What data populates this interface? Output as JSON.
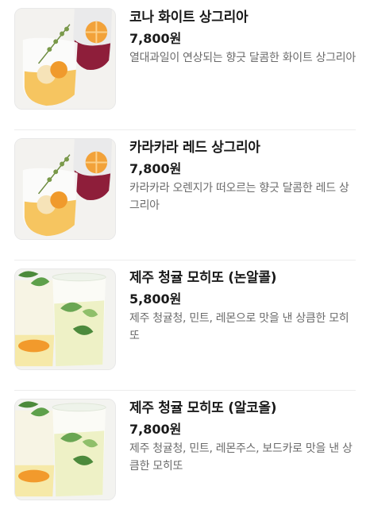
{
  "menu": {
    "items": [
      {
        "name": "코나 화이트 상그리아",
        "price": "7,800원",
        "description": "열대과일이 연상되는 향긋 달콤한 화이트 상그리아",
        "image_icon": "sangria-drink-image"
      },
      {
        "name": "카라카라 레드 상그리아",
        "price": "7,800원",
        "description": "카라카라 오렌지가 떠오르는 향긋 달콤한 레드 상그리아",
        "image_icon": "sangria-drink-image"
      },
      {
        "name": "제주 청귤 모히또 (논알콜)",
        "price": "5,800원",
        "description": "제주 청귤청, 민트, 레몬으로 맛을 낸 상큼한 모히또",
        "image_icon": "mojito-drink-image"
      },
      {
        "name": "제주 청귤 모히또 (알코올)",
        "price": "7,800원",
        "description": "제주 청귤청, 민트, 레몬주스, 보드카로 맛을 낸 상큼한 모히또",
        "image_icon": "mojito-drink-image"
      }
    ]
  }
}
